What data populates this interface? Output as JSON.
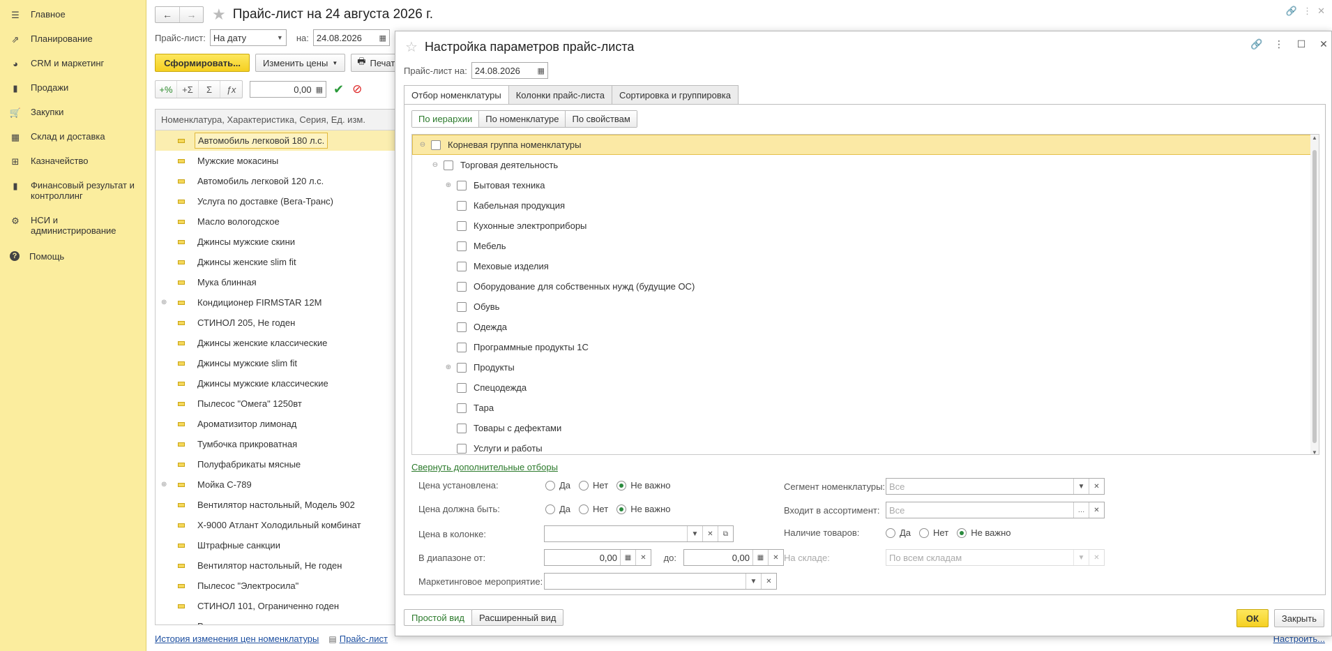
{
  "sidebar": {
    "items": [
      {
        "label": "Главное",
        "icon": "menu-icon"
      },
      {
        "label": "Планирование",
        "icon": "planning-icon"
      },
      {
        "label": "CRM и маркетинг",
        "icon": "pie-chart-icon"
      },
      {
        "label": "Продажи",
        "icon": "bag-icon"
      },
      {
        "label": "Закупки",
        "icon": "cart-icon"
      },
      {
        "label": "Склад и доставка",
        "icon": "warehouse-icon"
      },
      {
        "label": "Казначейство",
        "icon": "treasury-icon"
      },
      {
        "label": "Финансовый результат и контроллинг",
        "icon": "bar-chart-icon"
      },
      {
        "label": "НСИ и администрирование",
        "icon": "gear-icon"
      },
      {
        "label": "Помощь",
        "icon": "help-icon"
      }
    ]
  },
  "main": {
    "title": "Прайс-лист на 24 августа 2026 г.",
    "filter": {
      "pricelist_label": "Прайс-лист:",
      "pricelist_value": "На дату",
      "on_label": "на:",
      "date_value": "24.08.2026"
    },
    "actions": {
      "generate": "Сформировать...",
      "change_prices": "Изменить цены",
      "print": "Печат"
    },
    "formula": {
      "plus_percent": "+%",
      "plus_sigma": "+Σ",
      "sigma": "Σ",
      "fx": "ƒx",
      "value": "0,00"
    },
    "table": {
      "header": "Номенклатура, Характеристика, Серия, Ед. изм.",
      "rows": [
        {
          "name": "Автомобиль легковой 180 л.с.",
          "expandable": false,
          "selected": true
        },
        {
          "name": "Мужские мокасины",
          "expandable": false
        },
        {
          "name": "Автомобиль легковой 120 л.с.",
          "expandable": false
        },
        {
          "name": "Услуга по доставке (Вега-Транс)",
          "expandable": false
        },
        {
          "name": "Масло вологодское",
          "expandable": false
        },
        {
          "name": "Джинсы мужские скини",
          "expandable": false
        },
        {
          "name": "Джинсы женские slim fit",
          "expandable": false
        },
        {
          "name": "Мука блинная",
          "expandable": false
        },
        {
          "name": "Кондиционер FIRMSTAR 12M",
          "expandable": true
        },
        {
          "name": "СТИНОЛ 205, Не годен",
          "expandable": false
        },
        {
          "name": "Джинсы женские классические",
          "expandable": false
        },
        {
          "name": "Джинсы мужские slim fit",
          "expandable": false
        },
        {
          "name": "Джинсы мужские классические",
          "expandable": false
        },
        {
          "name": "Пылесос \"Омега\" 1250вт",
          "expandable": false
        },
        {
          "name": "Ароматизитор лимонад",
          "expandable": false
        },
        {
          "name": "Тумбочка прикроватная",
          "expandable": false
        },
        {
          "name": "Полуфабрикаты мясные",
          "expandable": false
        },
        {
          "name": "Мойка С-789",
          "expandable": true
        },
        {
          "name": "Вентилятор настольный, Модель 902",
          "expandable": false
        },
        {
          "name": "X-9000 Атлант Холодильный комбинат",
          "expandable": false
        },
        {
          "name": "Штрафные санкции",
          "expandable": false
        },
        {
          "name": "Вентилятор настольный, Не годен",
          "expandable": false
        },
        {
          "name": "Пылесос \"Электросила\"",
          "expandable": false
        },
        {
          "name": "СТИНОЛ 101, Ограниченно годен",
          "expandable": false
        },
        {
          "name": "Расходы на ремонт",
          "expandable": false
        }
      ]
    },
    "links": {
      "history": "История изменения цен номенклатуры",
      "pricelist": "Прайс-лист",
      "settings": "Настроить..."
    }
  },
  "dialog": {
    "title": "Настройка параметров прайс-листа",
    "date_label": "Прайс-лист на:",
    "date_value": "24.08.2026",
    "tabs": [
      "Отбор номенклатуры",
      "Колонки прайс-листа",
      "Сортировка и группировка"
    ],
    "subtabs": [
      "По иерархии",
      "По номенклатуре",
      "По свойствам"
    ],
    "tree": [
      {
        "label": "Корневая группа номенклатуры",
        "level": 0,
        "toggle": "⊖",
        "selected": true
      },
      {
        "label": "Торговая деятельность",
        "level": 1,
        "toggle": "⊖"
      },
      {
        "label": "Бытовая техника",
        "level": 2,
        "toggle": "⊕"
      },
      {
        "label": "Кабельная продукция",
        "level": 2,
        "toggle": ""
      },
      {
        "label": "Кухонные электроприборы",
        "level": 2,
        "toggle": ""
      },
      {
        "label": "Мебель",
        "level": 2,
        "toggle": ""
      },
      {
        "label": "Меховые изделия",
        "level": 2,
        "toggle": ""
      },
      {
        "label": "Оборудование для собственных нужд (будущие ОС)",
        "level": 2,
        "toggle": ""
      },
      {
        "label": "Обувь",
        "level": 2,
        "toggle": ""
      },
      {
        "label": "Одежда",
        "level": 2,
        "toggle": ""
      },
      {
        "label": "Программные продукты 1С",
        "level": 2,
        "toggle": ""
      },
      {
        "label": "Продукты",
        "level": 2,
        "toggle": "⊕"
      },
      {
        "label": "Спецодежда",
        "level": 2,
        "toggle": ""
      },
      {
        "label": "Тара",
        "level": 2,
        "toggle": ""
      },
      {
        "label": "Товары с дефектами",
        "level": 2,
        "toggle": ""
      },
      {
        "label": "Услуги и работы",
        "level": 2,
        "toggle": ""
      }
    ],
    "collapse_link": "Свернуть дополнительные отборы",
    "filters": {
      "price_set_label": "Цена установлена:",
      "price_must_label": "Цена должна быть:",
      "price_in_col_label": "Цена в колонке:",
      "range_from_label": "В диапазоне от:",
      "range_from_value": "0,00",
      "range_to_label": "до:",
      "range_to_value": "0,00",
      "marketing_label": "Маркетинговое мероприятие:",
      "segment_label": "Сегмент номенклатуры:",
      "segment_placeholder": "Все",
      "assortment_label": "Входит в ассортимент:",
      "assortment_placeholder": "Все",
      "availability_label": "Наличие товаров:",
      "warehouse_label": "На складе:",
      "warehouse_placeholder": "По всем складам",
      "opt_yes": "Да",
      "opt_no": "Нет",
      "opt_any": "Не важно"
    },
    "footer": {
      "simple_view": "Простой вид",
      "extended_view": "Расширенный вид",
      "ok": "ОК",
      "close": "Закрыть"
    }
  }
}
